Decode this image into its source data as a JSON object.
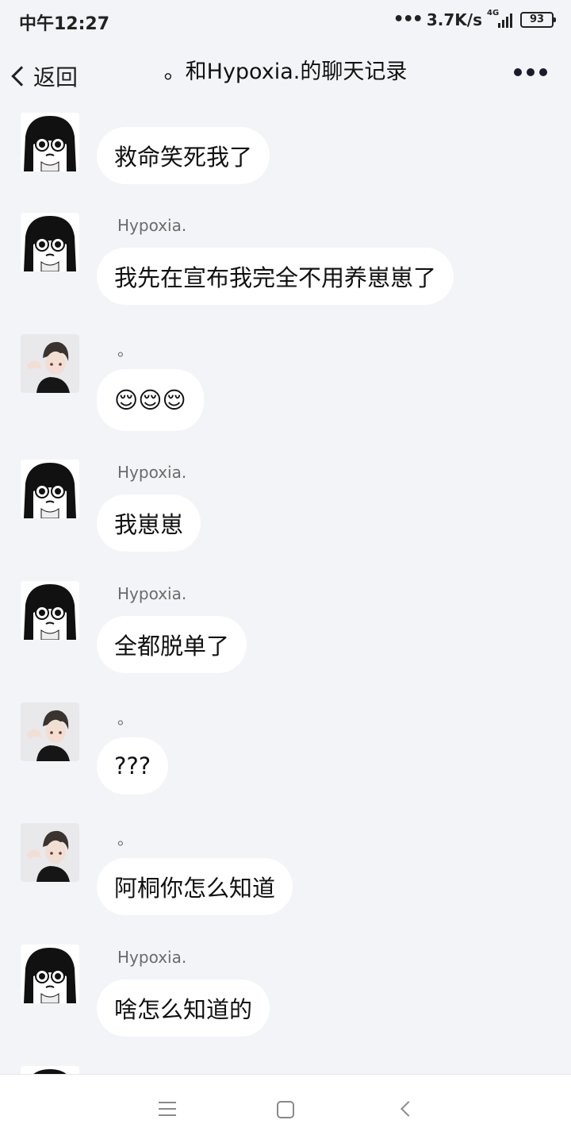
{
  "status": {
    "time": "中午12:27",
    "net_speed": "3.7K/s",
    "network": "4G",
    "battery": "93"
  },
  "header": {
    "back_label": "返回",
    "title": "。和Hypoxia.的聊天记录"
  },
  "messages": [
    {
      "sender": "",
      "text": "救命笑死我了",
      "avatar": "girl-avatar"
    },
    {
      "sender": "Hypoxia.",
      "text": "我先在宣布我完全不用养崽崽了",
      "avatar": "girl-avatar"
    },
    {
      "sender": "。",
      "text": "😌😌😌",
      "avatar": "boy-avatar"
    },
    {
      "sender": "Hypoxia.",
      "text": "我崽崽",
      "avatar": "girl-avatar"
    },
    {
      "sender": "Hypoxia.",
      "text": "全都脱单了",
      "avatar": "girl-avatar"
    },
    {
      "sender": "。",
      "text": "???",
      "avatar": "boy-avatar"
    },
    {
      "sender": "。",
      "text": "阿桐你怎么知道",
      "avatar": "boy-avatar"
    },
    {
      "sender": "Hypoxia.",
      "text": "啥怎么知道的",
      "avatar": "girl-avatar"
    }
  ]
}
